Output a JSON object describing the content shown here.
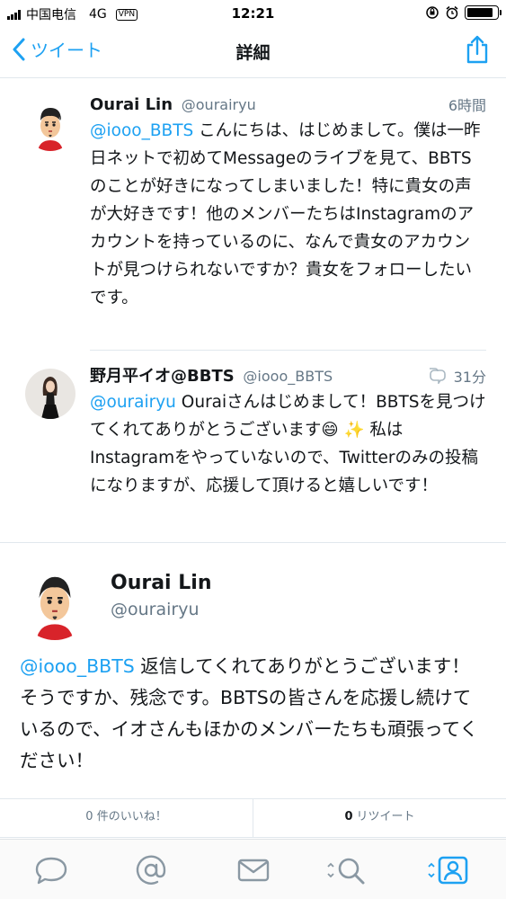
{
  "status": {
    "carrier": "中国电信",
    "network": "4G",
    "vpn": "VPN",
    "time": "12:21"
  },
  "nav": {
    "back_label": "ツイート",
    "title": "詳細"
  },
  "tweets": [
    {
      "name": "Ourai Lin",
      "handle": "@ourairyu",
      "time": "6時間",
      "mention": "@iooo_BBTS",
      "text": " こんにちは、はじめまして。僕は一昨日ネットで初めてMessageのライブを見て、BBTSのことが好きになってしまいました！特に貴女の声が大好きです！他のメンバーたちはInstagramのアカウントを持っているのに、なんで貴女のアカウントが見つけられないですか？貴女をフォローしたいです。"
    },
    {
      "name": "野月平イオ@BBTS",
      "handle": "@iooo_BBTS",
      "time": "31分",
      "mention": "@ourairyu",
      "text": " Ouraiさんはじめまして！BBTSを見つけてくれてありがとうございます😄 ✨ 私はInstagramをやっていないので、Twitterのみの投稿になりますが、応援して頂けると嬉しいです！"
    }
  ],
  "main": {
    "name": "Ourai Lin",
    "handle": "@ourairyu",
    "mention": "@iooo_BBTS",
    "text": " 返信してくれてありがとうございます！そうですか、残念です。BBTSの皆さんを応援し続けているので、イオさんもほかのメンバーたちも頑張ってください！"
  },
  "stats": {
    "likes_text": "0 件のいいね！",
    "retweets_count": "0",
    "retweets_label": "リツイート"
  },
  "colors": {
    "accent": "#1da1f2",
    "text": "#14171a",
    "secondary": "#657786"
  }
}
